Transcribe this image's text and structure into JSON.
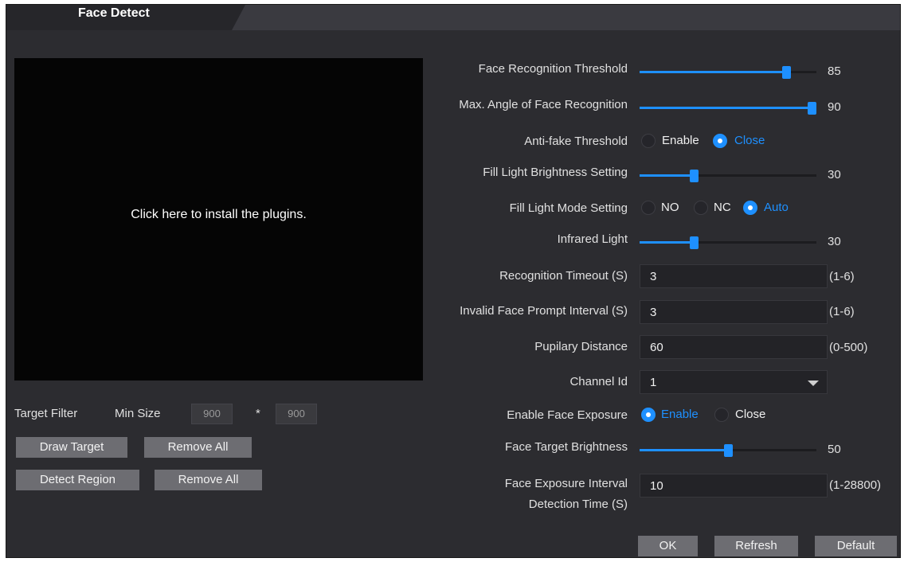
{
  "tab": {
    "label": "Face Detect"
  },
  "preview": {
    "text": "Click here to install the plugins."
  },
  "target_filter": {
    "label": "Target Filter",
    "min_size_label": "Min Size",
    "width": "900",
    "separator": "*",
    "height": "900"
  },
  "buttons": {
    "draw_target": "Draw Target",
    "remove_all_1": "Remove All",
    "detect_region": "Detect Region",
    "remove_all_2": "Remove All",
    "ok": "OK",
    "refresh": "Refresh",
    "default": "Default"
  },
  "settings": {
    "face_recognition_threshold": {
      "label": "Face Recognition Threshold",
      "value": "85",
      "level": 0.85
    },
    "max_angle": {
      "label": "Max. Angle of Face Recognition",
      "value": "90",
      "level": 1.0
    },
    "anti_fake": {
      "label": "Anti-fake Threshold",
      "options": [
        "Enable",
        "Close"
      ],
      "selected": "Close"
    },
    "fill_light_brightness": {
      "label": "Fill Light Brightness Setting",
      "value": "30",
      "level": 0.3
    },
    "fill_light_mode": {
      "label": "Fill Light Mode Setting",
      "options": [
        "NO",
        "NC",
        "Auto"
      ],
      "selected": "Auto"
    },
    "infrared_light": {
      "label": "Infrared Light",
      "value": "30",
      "level": 0.3
    },
    "recognition_timeout": {
      "label": "Recognition Timeout (S)",
      "value": "3",
      "range": "(1-6)"
    },
    "invalid_face_prompt": {
      "label": "Invalid Face Prompt Interval (S)",
      "value": "3",
      "range": "(1-6)"
    },
    "pupilary_distance": {
      "label": "Pupilary Distance",
      "value": "60",
      "range": "(0-500)"
    },
    "channel_id": {
      "label": "Channel Id",
      "value": "1"
    },
    "enable_face_exposure": {
      "label": "Enable Face Exposure",
      "options": [
        "Enable",
        "Close"
      ],
      "selected": "Enable"
    },
    "face_target_brightness": {
      "label": "Face Target Brightness",
      "value": "50",
      "level": 0.5
    },
    "face_exposure_interval": {
      "label_line1": "Face Exposure Interval",
      "label_line2": "Detection Time (S)",
      "value": "10",
      "range": "(1-28800)"
    }
  },
  "colors": {
    "accent": "#1e90ff",
    "background": "#2c2c30",
    "button": "#6d6d72"
  }
}
